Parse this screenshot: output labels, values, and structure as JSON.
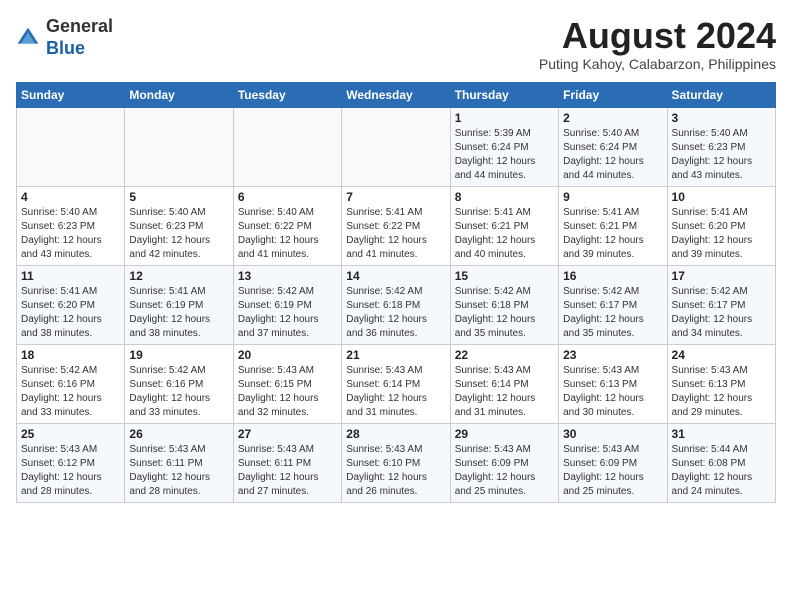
{
  "header": {
    "logo_line1": "General",
    "logo_line2": "Blue",
    "month_year": "August 2024",
    "location": "Puting Kahoy, Calabarzon, Philippines"
  },
  "weekdays": [
    "Sunday",
    "Monday",
    "Tuesday",
    "Wednesday",
    "Thursday",
    "Friday",
    "Saturday"
  ],
  "weeks": [
    [
      {
        "day": "",
        "info": ""
      },
      {
        "day": "",
        "info": ""
      },
      {
        "day": "",
        "info": ""
      },
      {
        "day": "",
        "info": ""
      },
      {
        "day": "1",
        "info": "Sunrise: 5:39 AM\nSunset: 6:24 PM\nDaylight: 12 hours\nand 44 minutes."
      },
      {
        "day": "2",
        "info": "Sunrise: 5:40 AM\nSunset: 6:24 PM\nDaylight: 12 hours\nand 44 minutes."
      },
      {
        "day": "3",
        "info": "Sunrise: 5:40 AM\nSunset: 6:23 PM\nDaylight: 12 hours\nand 43 minutes."
      }
    ],
    [
      {
        "day": "4",
        "info": "Sunrise: 5:40 AM\nSunset: 6:23 PM\nDaylight: 12 hours\nand 43 minutes."
      },
      {
        "day": "5",
        "info": "Sunrise: 5:40 AM\nSunset: 6:23 PM\nDaylight: 12 hours\nand 42 minutes."
      },
      {
        "day": "6",
        "info": "Sunrise: 5:40 AM\nSunset: 6:22 PM\nDaylight: 12 hours\nand 41 minutes."
      },
      {
        "day": "7",
        "info": "Sunrise: 5:41 AM\nSunset: 6:22 PM\nDaylight: 12 hours\nand 41 minutes."
      },
      {
        "day": "8",
        "info": "Sunrise: 5:41 AM\nSunset: 6:21 PM\nDaylight: 12 hours\nand 40 minutes."
      },
      {
        "day": "9",
        "info": "Sunrise: 5:41 AM\nSunset: 6:21 PM\nDaylight: 12 hours\nand 39 minutes."
      },
      {
        "day": "10",
        "info": "Sunrise: 5:41 AM\nSunset: 6:20 PM\nDaylight: 12 hours\nand 39 minutes."
      }
    ],
    [
      {
        "day": "11",
        "info": "Sunrise: 5:41 AM\nSunset: 6:20 PM\nDaylight: 12 hours\nand 38 minutes."
      },
      {
        "day": "12",
        "info": "Sunrise: 5:41 AM\nSunset: 6:19 PM\nDaylight: 12 hours\nand 38 minutes."
      },
      {
        "day": "13",
        "info": "Sunrise: 5:42 AM\nSunset: 6:19 PM\nDaylight: 12 hours\nand 37 minutes."
      },
      {
        "day": "14",
        "info": "Sunrise: 5:42 AM\nSunset: 6:18 PM\nDaylight: 12 hours\nand 36 minutes."
      },
      {
        "day": "15",
        "info": "Sunrise: 5:42 AM\nSunset: 6:18 PM\nDaylight: 12 hours\nand 35 minutes."
      },
      {
        "day": "16",
        "info": "Sunrise: 5:42 AM\nSunset: 6:17 PM\nDaylight: 12 hours\nand 35 minutes."
      },
      {
        "day": "17",
        "info": "Sunrise: 5:42 AM\nSunset: 6:17 PM\nDaylight: 12 hours\nand 34 minutes."
      }
    ],
    [
      {
        "day": "18",
        "info": "Sunrise: 5:42 AM\nSunset: 6:16 PM\nDaylight: 12 hours\nand 33 minutes."
      },
      {
        "day": "19",
        "info": "Sunrise: 5:42 AM\nSunset: 6:16 PM\nDaylight: 12 hours\nand 33 minutes."
      },
      {
        "day": "20",
        "info": "Sunrise: 5:43 AM\nSunset: 6:15 PM\nDaylight: 12 hours\nand 32 minutes."
      },
      {
        "day": "21",
        "info": "Sunrise: 5:43 AM\nSunset: 6:14 PM\nDaylight: 12 hours\nand 31 minutes."
      },
      {
        "day": "22",
        "info": "Sunrise: 5:43 AM\nSunset: 6:14 PM\nDaylight: 12 hours\nand 31 minutes."
      },
      {
        "day": "23",
        "info": "Sunrise: 5:43 AM\nSunset: 6:13 PM\nDaylight: 12 hours\nand 30 minutes."
      },
      {
        "day": "24",
        "info": "Sunrise: 5:43 AM\nSunset: 6:13 PM\nDaylight: 12 hours\nand 29 minutes."
      }
    ],
    [
      {
        "day": "25",
        "info": "Sunrise: 5:43 AM\nSunset: 6:12 PM\nDaylight: 12 hours\nand 28 minutes."
      },
      {
        "day": "26",
        "info": "Sunrise: 5:43 AM\nSunset: 6:11 PM\nDaylight: 12 hours\nand 28 minutes."
      },
      {
        "day": "27",
        "info": "Sunrise: 5:43 AM\nSunset: 6:11 PM\nDaylight: 12 hours\nand 27 minutes."
      },
      {
        "day": "28",
        "info": "Sunrise: 5:43 AM\nSunset: 6:10 PM\nDaylight: 12 hours\nand 26 minutes."
      },
      {
        "day": "29",
        "info": "Sunrise: 5:43 AM\nSunset: 6:09 PM\nDaylight: 12 hours\nand 25 minutes."
      },
      {
        "day": "30",
        "info": "Sunrise: 5:43 AM\nSunset: 6:09 PM\nDaylight: 12 hours\nand 25 minutes."
      },
      {
        "day": "31",
        "info": "Sunrise: 5:44 AM\nSunset: 6:08 PM\nDaylight: 12 hours\nand 24 minutes."
      }
    ]
  ]
}
